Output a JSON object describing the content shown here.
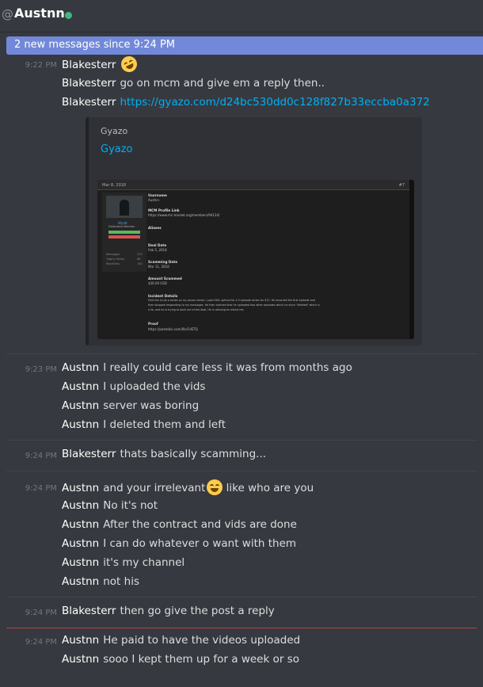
{
  "header": {
    "at": "@",
    "title": "Austnn"
  },
  "banner": {
    "text": "2 new messages since 9:24 PM"
  },
  "colors": {
    "background": "#36393f",
    "banner": "#7289da",
    "link": "#00b0f4",
    "online": "#43b581"
  },
  "groups": [
    {
      "time": "9:22 PM",
      "lines": [
        {
          "author": "Blakesterr",
          "text": "",
          "emoji": "rolling-on-floor-laughing"
        },
        {
          "author": "Blakesterr",
          "text": "go on mcm and give em a reply then.."
        },
        {
          "author": "Blakesterr",
          "link": "https://gyazo.com/d24bc530dd0c128f827b33eccba0a372"
        }
      ]
    },
    {
      "time": "9:23 PM",
      "lines": [
        {
          "author": "Austnn",
          "text": "I really could care less it was from months ago"
        },
        {
          "author": "Austnn",
          "text": "I uploaded the vids"
        },
        {
          "author": "Austnn",
          "text": "server was boring"
        },
        {
          "author": "Austnn",
          "text": "I deleted them and left"
        }
      ]
    },
    {
      "time": "9:24 PM",
      "lines": [
        {
          "author": "Blakesterr",
          "text": "thats basically scamming..."
        }
      ]
    },
    {
      "time": "9:24 PM",
      "lines": [
        {
          "author": "Austnn",
          "text": "and your irrelevant",
          "emoji": "joy",
          "text_after": "like who are you"
        },
        {
          "author": "Austnn",
          "text": "No it's not"
        },
        {
          "author": "Austnn",
          "text": "After the contract and vids are done"
        },
        {
          "author": "Austnn",
          "text": "I can do whatever o want with them"
        },
        {
          "author": "Austnn",
          "text": "it's my channel"
        },
        {
          "author": "Austnn",
          "text": "not his"
        }
      ]
    },
    {
      "time": "9:24 PM",
      "lines": [
        {
          "author": "Blakesterr",
          "text": "then go give the post a reply"
        }
      ]
    },
    {
      "time": "9:24 PM",
      "lines": [
        {
          "author": "Austnn",
          "text": "He paid to have the videos uploaded"
        },
        {
          "author": "Austnn",
          "text": "sooo I kept them up for a week or so"
        }
      ]
    }
  ],
  "embed": {
    "provider": "Gyazo",
    "title": "Gyazo",
    "screenshot": {
      "date": "Mar 8, 2018",
      "hash": "#7",
      "profile_name": "Wyatt",
      "profile_role": "Dedicated Member",
      "fields": [
        {
          "label": "Username",
          "value": "Austnn"
        },
        {
          "label": "MCM Profile Link",
          "value": "https://www.mc-market.org/members/94134/"
        },
        {
          "label": "Aliases",
          "value": ""
        },
        {
          "label": "Deal Date",
          "value": "Feb 5, 2018"
        },
        {
          "label": "Scamming Date",
          "value": "Mar 11, 2018"
        },
        {
          "label": "Amount Scammed",
          "value": "$36.00 USD"
        },
        {
          "label": "Incident Details",
          "value": "Paid him to do a series on my prison server. I paid 50% upfront for a 5 episode series for $72. He recorded the first episode and"
        },
        {
          "label": "",
          "value": "then stopped responding to my messages. He then claimed that he uploaded two other episodes which he since \"deleted\" which is"
        },
        {
          "label": "",
          "value": "a lie, and he is trying to back out of the deal. He is refusing to refund me."
        },
        {
          "label": "Proof",
          "value": "https://pastebin.com/0kcFdETQ"
        }
      ],
      "side_fields": [
        {
          "label": "Messages",
          "value": "233"
        },
        {
          "label": "Trophy Points",
          "value": "66"
        },
        {
          "label": "Reactions",
          "value": "140"
        }
      ]
    }
  }
}
